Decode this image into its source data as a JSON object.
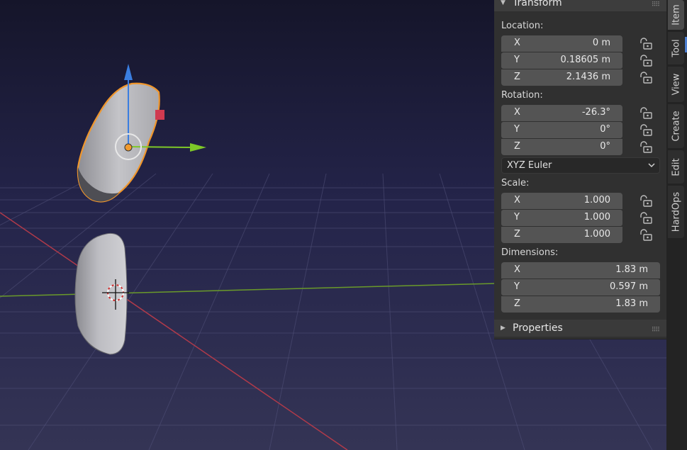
{
  "panel": {
    "transform_title": "Transform",
    "location_label": "Location:",
    "location": [
      {
        "axis": "X",
        "value": "0 m"
      },
      {
        "axis": "Y",
        "value": "0.18605 m"
      },
      {
        "axis": "Z",
        "value": "2.1436 m"
      }
    ],
    "rotation_label": "Rotation:",
    "rotation": [
      {
        "axis": "X",
        "value": "-26.3°"
      },
      {
        "axis": "Y",
        "value": "0°"
      },
      {
        "axis": "Z",
        "value": "0°"
      }
    ],
    "rotation_mode": "XYZ Euler",
    "scale_label": "Scale:",
    "scale": [
      {
        "axis": "X",
        "value": "1.000"
      },
      {
        "axis": "Y",
        "value": "1.000"
      },
      {
        "axis": "Z",
        "value": "1.000"
      }
    ],
    "dimensions_label": "Dimensions:",
    "dimensions": [
      {
        "axis": "X",
        "value": "1.83 m"
      },
      {
        "axis": "Y",
        "value": "0.597 m"
      },
      {
        "axis": "Z",
        "value": "1.83 m"
      }
    ],
    "properties_title": "Properties"
  },
  "tabs": [
    "Item",
    "Tool",
    "View",
    "Create",
    "Edit",
    "HardOps"
  ],
  "colors": {
    "x_axis_red": "#d04050",
    "y_axis_green": "#7ec828",
    "z_axis_blue": "#3a7ee0",
    "selection_orange": "#f0962c"
  }
}
